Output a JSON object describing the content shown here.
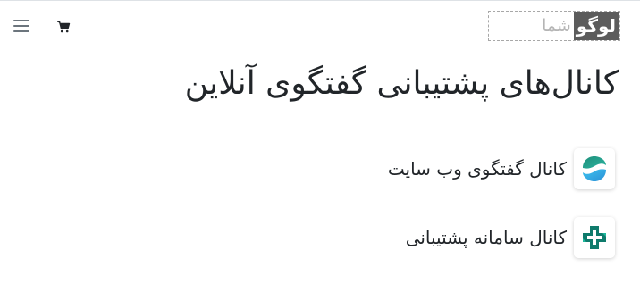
{
  "header": {
    "menu_icon": "hamburger-menu-icon",
    "cart_icon": "shopping-cart-icon",
    "logo": {
      "dark_text": "لوگو",
      "light_text": "شما"
    }
  },
  "main": {
    "title": "کانال‌های پشتیبانی گفتگوی آنلاین",
    "channels": [
      {
        "label": "کانال گفتگوی وب سایت",
        "icon": "website-chat-channel-icon"
      },
      {
        "label": "کانال سامانه پشتیبانی",
        "icon": "helpdesk-channel-icon"
      }
    ]
  },
  "colors": {
    "chat_icon_top": "#2a9d8f",
    "chat_icon_bottom": "#3db8e8",
    "helpdesk_icon": "#0f7b6c"
  }
}
